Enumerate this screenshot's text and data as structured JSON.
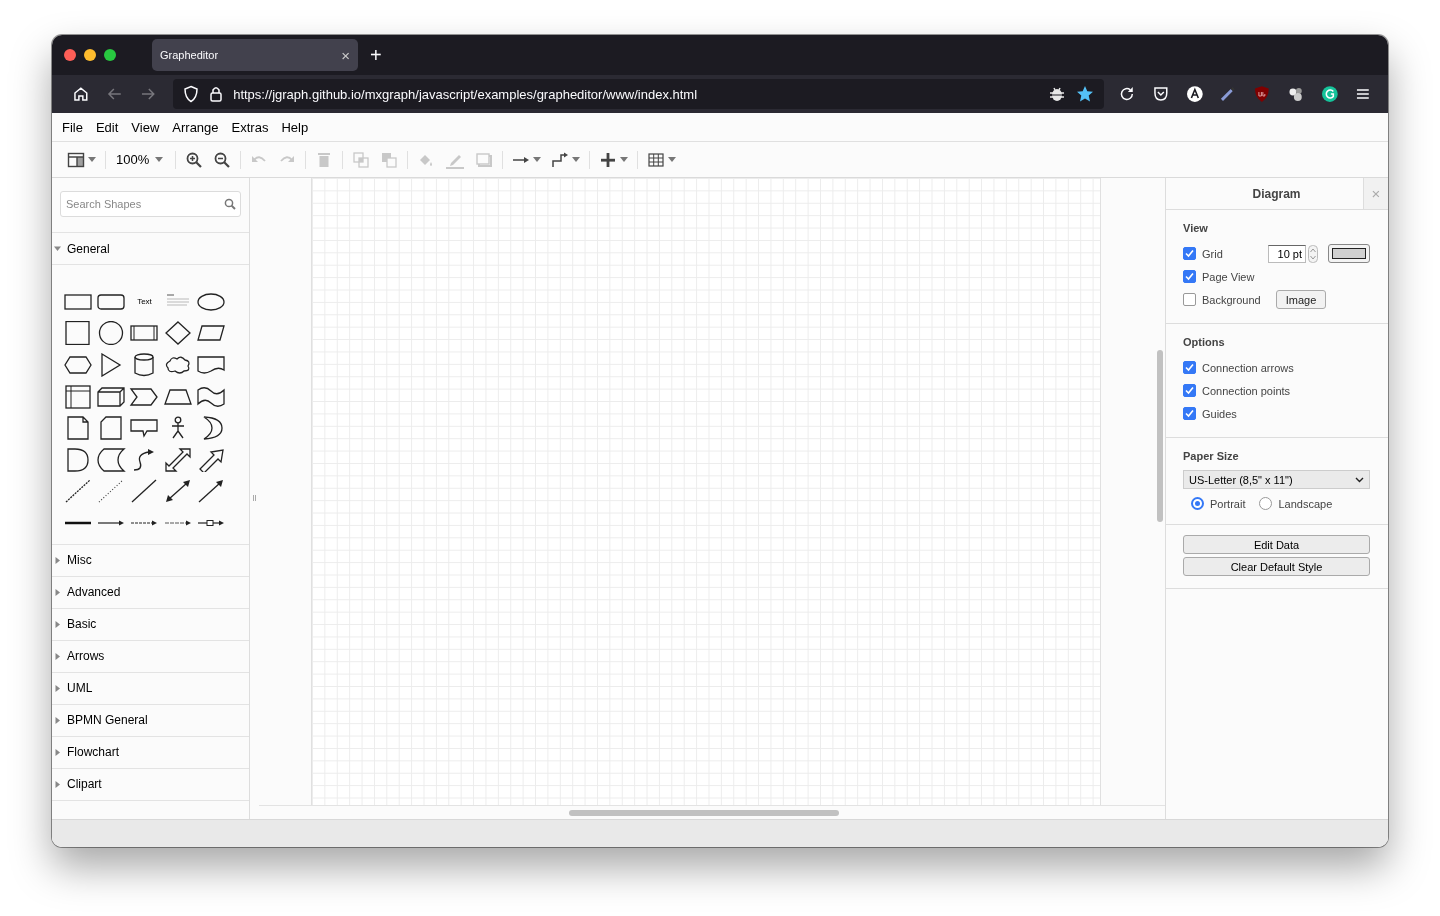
{
  "browser": {
    "tab_title": "Grapheditor",
    "tab_close": "×",
    "new_tab": "+",
    "url": "https://jgraph.github.io/mxgraph/javascript/examples/grapheditor/www/index.html"
  },
  "menu": [
    "File",
    "Edit",
    "View",
    "Arrange",
    "Extras",
    "Help"
  ],
  "toolbar": {
    "groups": [
      [
        {
          "kind": "panels",
          "disabled": false,
          "dropdown": true
        }
      ],
      [
        {
          "kind": "zoom",
          "label": "100%",
          "disabled": false,
          "dropdown": true
        }
      ],
      [
        {
          "kind": "zoom_in",
          "disabled": false,
          "dropdown": false
        },
        {
          "kind": "zoom_out",
          "disabled": false,
          "dropdown": false
        }
      ],
      [
        {
          "kind": "undo",
          "disabled": true,
          "dropdown": false
        },
        {
          "kind": "redo",
          "disabled": true,
          "dropdown": false
        }
      ],
      [
        {
          "kind": "delete",
          "disabled": true,
          "dropdown": false
        }
      ],
      [
        {
          "kind": "to_front",
          "disabled": true,
          "dropdown": false
        },
        {
          "kind": "to_back",
          "disabled": true,
          "dropdown": false
        }
      ],
      [
        {
          "kind": "fill",
          "disabled": true,
          "dropdown": false
        },
        {
          "kind": "line_color",
          "disabled": true,
          "dropdown": false
        },
        {
          "kind": "shadow",
          "disabled": true,
          "dropdown": false
        }
      ],
      [
        {
          "kind": "connection",
          "disabled": false,
          "dropdown": true
        },
        {
          "kind": "waypoint",
          "disabled": false,
          "dropdown": true
        }
      ],
      [
        {
          "kind": "insert",
          "disabled": false,
          "dropdown": true
        }
      ],
      [
        {
          "kind": "table",
          "disabled": false,
          "dropdown": true
        }
      ]
    ]
  },
  "sidebar": {
    "search": {
      "placeholder": "Search Shapes"
    },
    "shape_label": "Text",
    "sections": [
      {
        "label": "General",
        "expanded": true
      },
      {
        "label": "Misc",
        "expanded": false
      },
      {
        "label": "Advanced",
        "expanded": false
      },
      {
        "label": "Basic",
        "expanded": false
      },
      {
        "label": "Arrows",
        "expanded": false
      },
      {
        "label": "UML",
        "expanded": false
      },
      {
        "label": "BPMN General",
        "expanded": false
      },
      {
        "label": "Flowchart",
        "expanded": false
      },
      {
        "label": "Clipart",
        "expanded": false
      }
    ]
  },
  "format_panel": {
    "title": "Diagram",
    "close": "×",
    "view": {
      "heading": "View",
      "grid": {
        "label": "Grid",
        "checked": true,
        "value": "10 pt"
      },
      "page_view": {
        "label": "Page View",
        "checked": true
      },
      "background": {
        "label": "Background",
        "checked": false,
        "button": "Image"
      }
    },
    "options": {
      "heading": "Options",
      "items": [
        {
          "label": "Connection arrows",
          "checked": true
        },
        {
          "label": "Connection points",
          "checked": true
        },
        {
          "label": "Guides",
          "checked": true
        }
      ]
    },
    "paper": {
      "heading": "Paper Size",
      "value": "US-Letter (8,5\" x 11\")",
      "orientation": [
        {
          "label": "Portrait",
          "selected": true
        },
        {
          "label": "Landscape",
          "selected": false
        }
      ]
    },
    "buttons": [
      "Edit Data",
      "Clear Default Style"
    ]
  }
}
